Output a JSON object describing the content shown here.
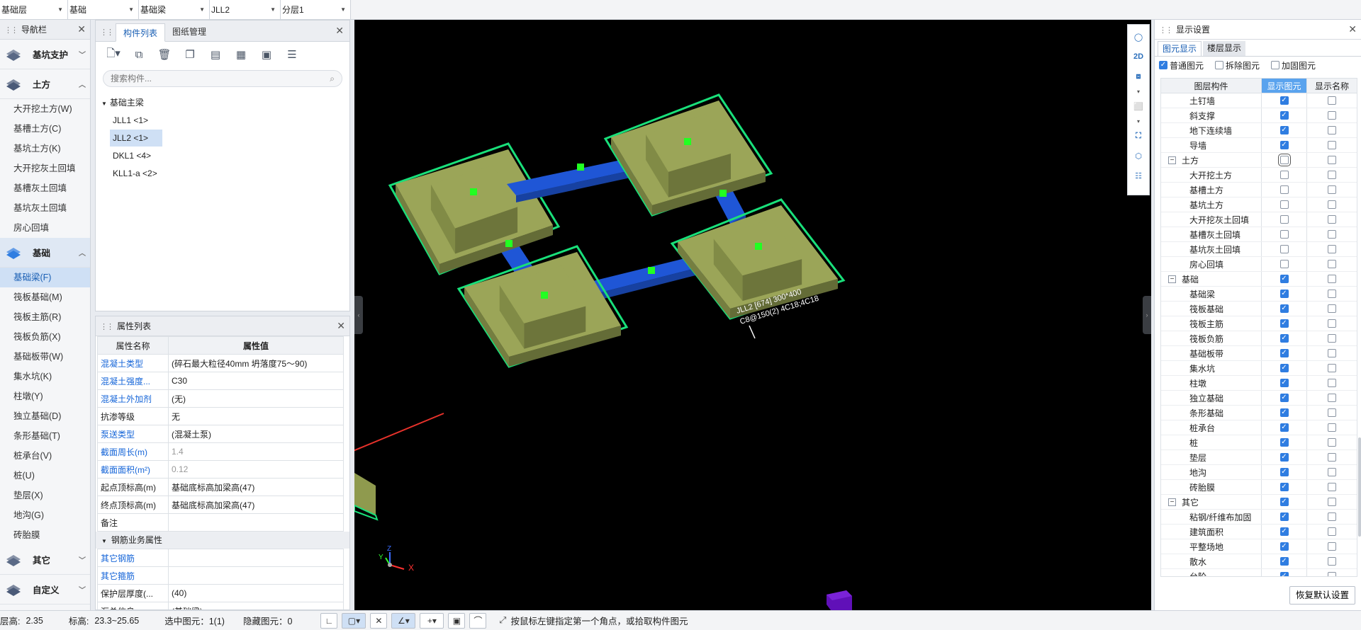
{
  "topbar": {
    "dropdowns": [
      {
        "value": "基础层",
        "width": 96
      },
      {
        "value": "基础",
        "width": 100
      },
      {
        "value": "基础梁",
        "width": 100
      },
      {
        "value": "JLL2",
        "width": 100
      },
      {
        "value": "分层1",
        "width": 99
      }
    ]
  },
  "nav": {
    "title": "导航栏",
    "groups": [
      {
        "label": "基坑支护",
        "expanded": false,
        "items": []
      },
      {
        "label": "土方",
        "expanded": true,
        "items": [
          "大开挖土方(W)",
          "基槽土方(C)",
          "基坑土方(K)",
          "大开挖灰土回填",
          "基槽灰土回填",
          "基坑灰土回填",
          "房心回填"
        ]
      },
      {
        "label": "基础",
        "expanded": true,
        "items": [
          "基础梁(F)",
          "筏板基础(M)",
          "筏板主筋(R)",
          "筏板负筋(X)",
          "基础板带(W)",
          "集水坑(K)",
          "柱墩(Y)",
          "独立基础(D)",
          "条形基础(T)",
          "桩承台(V)",
          "桩(U)",
          "垫层(X)",
          "地沟(G)",
          "砖胎膜"
        ]
      },
      {
        "label": "其它",
        "expanded": false,
        "items": []
      },
      {
        "label": "自定义",
        "expanded": false,
        "items": []
      }
    ],
    "selected": "基础梁(F)"
  },
  "components": {
    "tabs": [
      "构件列表",
      "图纸管理"
    ],
    "search_placeholder": "搜索构件...",
    "tree_root": "基础主梁",
    "items": [
      "JLL1 <1>",
      "JLL2 <1>",
      "DKL1 <4>",
      "KLL1-a <2>"
    ],
    "selected": "JLL2 <1>"
  },
  "properties": {
    "title": "属性列表",
    "col_name": "属性名称",
    "col_value": "属性值",
    "rows": [
      {
        "name": "混凝土类型",
        "value": "(碎石最大粒径40mm 坍落度75～90)",
        "blue": true,
        "gray": false
      },
      {
        "name": "混凝土强度...",
        "value": "C30",
        "blue": true,
        "gray": false
      },
      {
        "name": "混凝土外加剂",
        "value": "(无)",
        "blue": true,
        "gray": false
      },
      {
        "name": "抗渗等级",
        "value": "无",
        "blue": false,
        "gray": false
      },
      {
        "name": "泵送类型",
        "value": "(混凝土泵)",
        "blue": true,
        "gray": false
      },
      {
        "name": "截面周长(m)",
        "value": "1.4",
        "blue": true,
        "gray": true
      },
      {
        "name": "截面面积(m²)",
        "value": "0.12",
        "blue": true,
        "gray": true
      },
      {
        "name": "起点顶标高(m)",
        "value": "基础底标高加梁高(47)",
        "blue": false,
        "gray": false
      },
      {
        "name": "终点顶标高(m)",
        "value": "基础底标高加梁高(47)",
        "blue": false,
        "gray": false
      },
      {
        "name": "备注",
        "value": "",
        "blue": false,
        "gray": false
      }
    ],
    "section": "钢筋业务属性",
    "rows2": [
      {
        "name": "其它钢筋",
        "value": "",
        "blue": true
      },
      {
        "name": "其它箍筋",
        "value": "",
        "blue": true
      },
      {
        "name": "保护层厚度(...",
        "value": "(40)",
        "blue": false
      },
      {
        "name": "汇总信息",
        "value": "(基础梁)",
        "blue": false
      }
    ]
  },
  "viewport": {
    "annotation_line1": "JLL2 [674] 300*400",
    "annotation_line2": "C8@150(2) 4C18;4C18",
    "colors": {
      "footing": "#8f9a4e",
      "footing_top": "#9ba558",
      "beam": "#1f56d6",
      "edge": "#19e07a",
      "marker": "#22ff22",
      "arrow": "#e8322b"
    }
  },
  "display": {
    "title": "显示设置",
    "tabs": [
      "图元显示",
      "楼层显示"
    ],
    "options": [
      {
        "label": "普通图元",
        "checked": true
      },
      {
        "label": "拆除图元",
        "checked": false
      },
      {
        "label": "加固图元",
        "checked": false
      }
    ],
    "col1": "图层构件",
    "col2": "显示图元",
    "col3": "显示名称",
    "rows": [
      {
        "label": "土钉墙",
        "type": "child",
        "show": true,
        "name": false
      },
      {
        "label": "斜支撑",
        "type": "child",
        "show": true,
        "name": false
      },
      {
        "label": "地下连续墙",
        "type": "child",
        "show": true,
        "name": false
      },
      {
        "label": "导墙",
        "type": "child",
        "show": true,
        "name": false
      },
      {
        "label": "土方",
        "type": "group",
        "show": false,
        "name": false,
        "focus": true
      },
      {
        "label": "大开挖土方",
        "type": "child",
        "show": false,
        "name": false
      },
      {
        "label": "基槽土方",
        "type": "child",
        "show": false,
        "name": false
      },
      {
        "label": "基坑土方",
        "type": "child",
        "show": false,
        "name": false
      },
      {
        "label": "大开挖灰土回填",
        "type": "child",
        "show": false,
        "name": false
      },
      {
        "label": "基槽灰土回填",
        "type": "child",
        "show": false,
        "name": false
      },
      {
        "label": "基坑灰土回填",
        "type": "child",
        "show": false,
        "name": false
      },
      {
        "label": "房心回填",
        "type": "child",
        "show": false,
        "name": false
      },
      {
        "label": "基础",
        "type": "group",
        "show": true,
        "name": false
      },
      {
        "label": "基础梁",
        "type": "child",
        "show": true,
        "name": false
      },
      {
        "label": "筏板基础",
        "type": "child",
        "show": true,
        "name": false
      },
      {
        "label": "筏板主筋",
        "type": "child",
        "show": true,
        "name": false
      },
      {
        "label": "筏板负筋",
        "type": "child",
        "show": true,
        "name": false
      },
      {
        "label": "基础板带",
        "type": "child",
        "show": true,
        "name": false
      },
      {
        "label": "集水坑",
        "type": "child",
        "show": true,
        "name": false
      },
      {
        "label": "柱墩",
        "type": "child",
        "show": true,
        "name": false
      },
      {
        "label": "独立基础",
        "type": "child",
        "show": true,
        "name": false
      },
      {
        "label": "条形基础",
        "type": "child",
        "show": true,
        "name": false
      },
      {
        "label": "桩承台",
        "type": "child",
        "show": true,
        "name": false
      },
      {
        "label": "桩",
        "type": "child",
        "show": true,
        "name": false
      },
      {
        "label": "垫层",
        "type": "child",
        "show": true,
        "name": false
      },
      {
        "label": "地沟",
        "type": "child",
        "show": true,
        "name": false
      },
      {
        "label": "砖胎膜",
        "type": "child",
        "show": true,
        "name": false
      },
      {
        "label": "其它",
        "type": "group",
        "show": true,
        "name": false
      },
      {
        "label": "粘钢/纤维布加固",
        "type": "child",
        "show": true,
        "name": false
      },
      {
        "label": "建筑面积",
        "type": "child",
        "show": true,
        "name": false
      },
      {
        "label": "平整场地",
        "type": "child",
        "show": true,
        "name": false
      },
      {
        "label": "散水",
        "type": "child",
        "show": true,
        "name": false
      },
      {
        "label": "台阶",
        "type": "child",
        "show": true,
        "name": false
      }
    ],
    "restore_label": "恢复默认设置"
  },
  "status": {
    "floor_height": "层高:",
    "floor_height_value": "2.35",
    "elev": "标高:",
    "elev_value": "23.3~25.65",
    "selected": "选中图元：1(1)",
    "hidden": "隐藏图元：0",
    "hint": "按鼠标左键指定第一个角点，或拾取构件图元"
  }
}
